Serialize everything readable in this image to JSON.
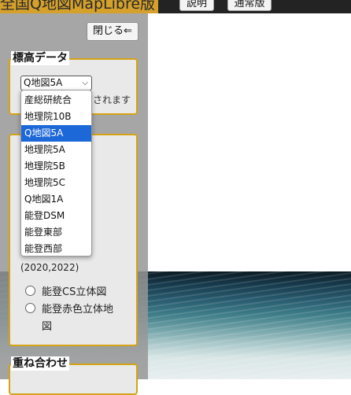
{
  "header": {
    "app_title": "全国Q地図MapLibre版",
    "help_button": "説明",
    "mode_button": "通常版"
  },
  "panel": {
    "close_button": "閉じる⇐",
    "elevation": {
      "legend": "標高データ",
      "selected": "Q地図5A",
      "note": "されます",
      "options": [
        "産総研統合",
        "地理院10B",
        "Q地図5A",
        "地理院5A",
        "地理院5B",
        "地理院5C",
        "Q地図1A",
        "能登DSM",
        "能登東部",
        "能登西部"
      ],
      "selected_index": 2
    },
    "layers": {
      "years_text": "(2020,2022)",
      "radio1": "能登CS立体図",
      "radio2": "能登赤色立体地図"
    },
    "overlay": {
      "legend": "重ね合わせ"
    }
  },
  "colors": {
    "accent": "#d6a316",
    "title_bg": "#d5a12b",
    "selection": "#1d68d8"
  }
}
